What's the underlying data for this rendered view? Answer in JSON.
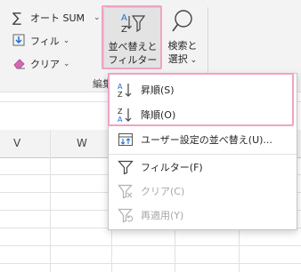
{
  "ribbon": {
    "autosum_label": "オート SUM",
    "fill_label": "フィル",
    "clear_label": "クリア",
    "sort_filter_line1": "並べ替えと",
    "sort_filter_line2": "フィルター",
    "find_line1": "検索と",
    "find_line2": "選択",
    "group_label": "編集"
  },
  "sheet": {
    "columns": [
      "V",
      "W"
    ]
  },
  "menu": {
    "items": [
      {
        "label": "昇順(S)",
        "icon": "sort-ascending-icon",
        "enabled": true
      },
      {
        "label": "降順(O)",
        "icon": "sort-descending-icon",
        "enabled": true
      },
      {
        "label": "ユーザー設定の並べ替え(U)...",
        "icon": "custom-sort-icon",
        "enabled": true
      },
      {
        "label": "フィルター(F)",
        "icon": "filter-icon",
        "enabled": true
      },
      {
        "label": "クリア(C)",
        "icon": "clear-filter-icon",
        "enabled": false
      },
      {
        "label": "再適用(Y)",
        "icon": "reapply-icon",
        "enabled": false
      }
    ]
  },
  "colors": {
    "highlight": "#f0a3c4",
    "accent_blue": "#1f6fd1",
    "ribbon_bg": "#f3f3f3"
  }
}
